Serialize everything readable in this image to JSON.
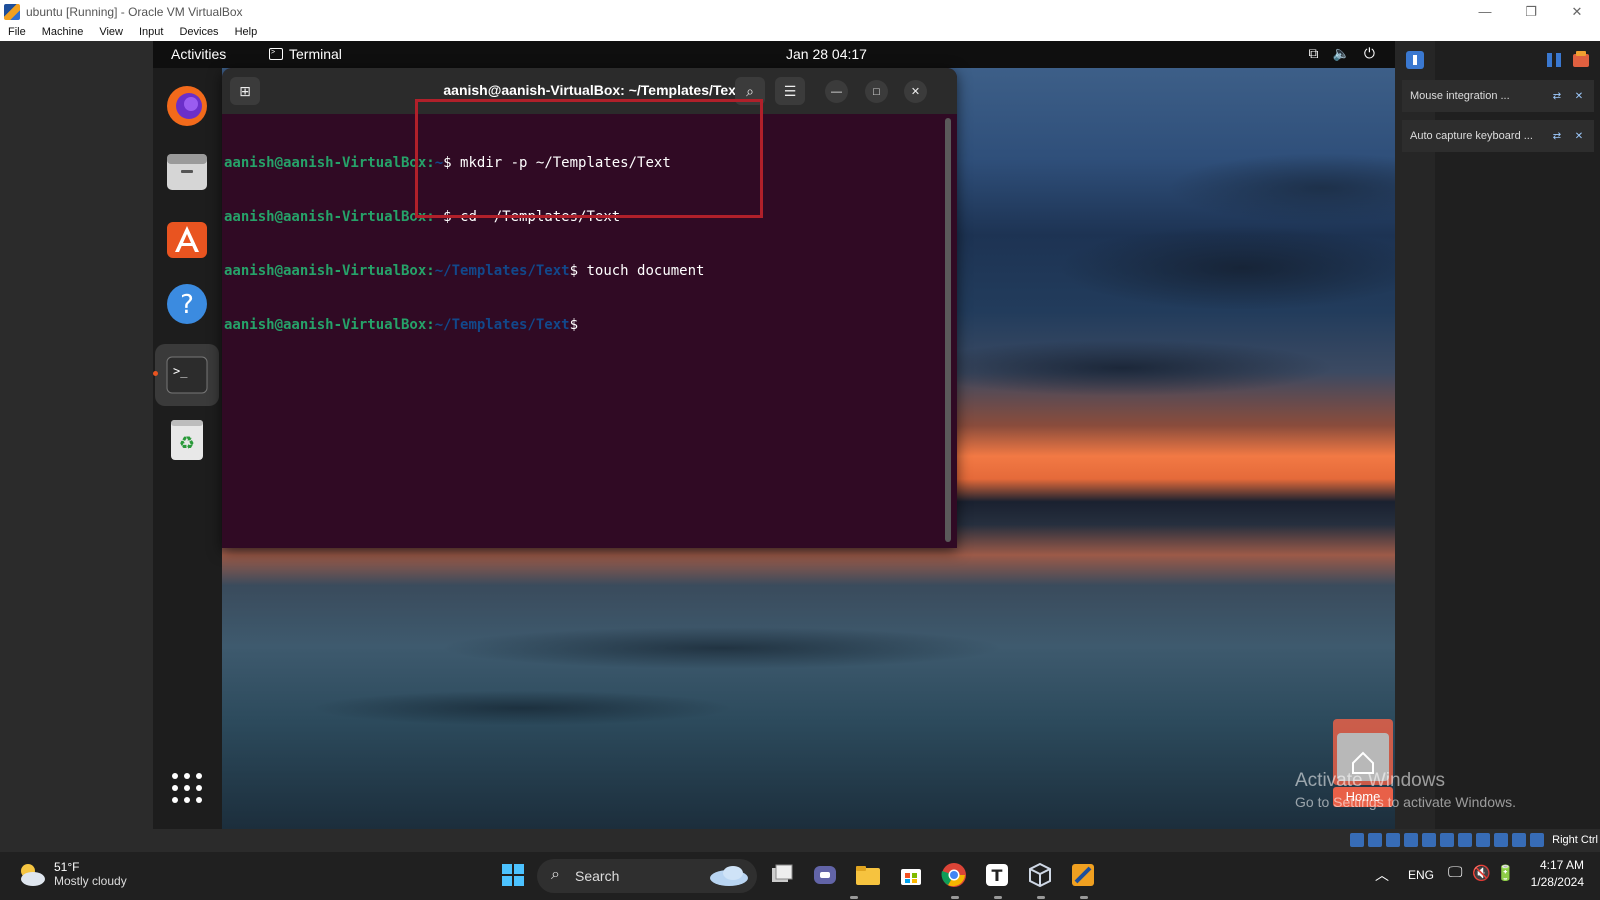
{
  "vbox": {
    "title": "ubuntu [Running] - Oracle VM VirtualBox",
    "menu": [
      "File",
      "Machine",
      "View",
      "Input",
      "Devices",
      "Help"
    ],
    "window_controls": {
      "minimize": "—",
      "restore": "❐",
      "close": "✕"
    }
  },
  "ubuntu": {
    "activities": "Activities",
    "app_name": "Terminal",
    "clock": "Jan 28  04:17",
    "dock_items": [
      "firefox",
      "files",
      "software",
      "help",
      "terminal",
      "trash",
      "app-grid"
    ]
  },
  "terminal": {
    "title": "aanish@aanish-VirtualBox: ~/Templates/Text",
    "lines": [
      {
        "user": "aanish@aanish-VirtualBox",
        "path": "~",
        "cmd": " mkdir -p ~/Templates/Text"
      },
      {
        "user": "aanish@aanish-VirtualBox",
        "path": "~",
        "cmd": " cd ~/Templates/Text"
      },
      {
        "user": "aanish@aanish-VirtualBox",
        "path": "~/Templates/Text",
        "cmd": " touch document"
      },
      {
        "user": "aanish@aanish-VirtualBox",
        "path": "~/Templates/Text",
        "cmd": ""
      }
    ]
  },
  "notifications": {
    "mouse": "Mouse integration ...",
    "keyboard": "Auto capture keyboard ..."
  },
  "desktop": {
    "home_label": "Home"
  },
  "watermark": {
    "title": "Activate Windows",
    "subtitle": "Go to Settings to activate Windows."
  },
  "vm_status": {
    "host_key": "Right Ctrl"
  },
  "taskbar": {
    "weather_temp": "51°F",
    "weather_desc": "Mostly cloudy",
    "search": "Search",
    "lang": "ENG",
    "time": "4:17 AM",
    "date": "1/28/2024"
  }
}
